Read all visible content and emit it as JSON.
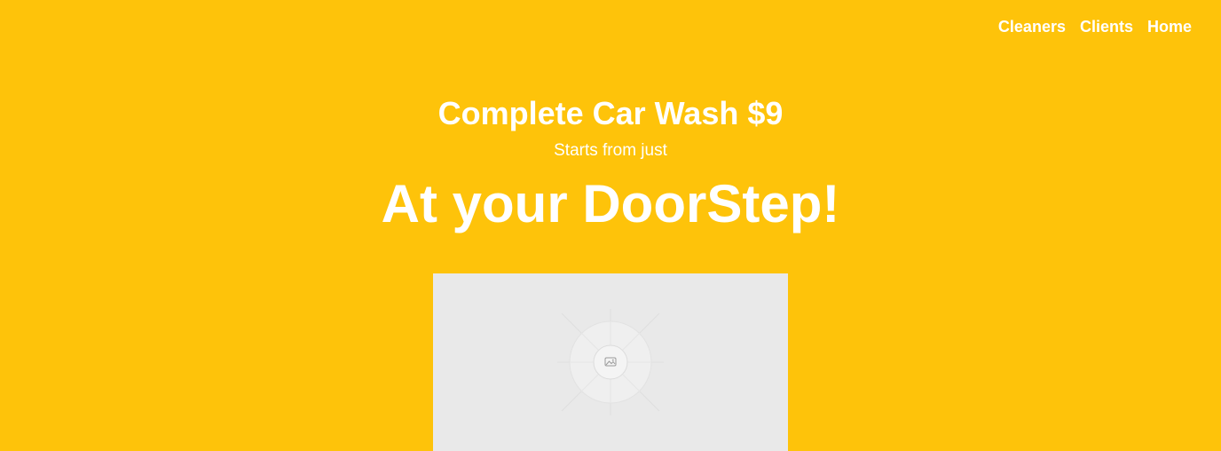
{
  "nav": {
    "items": [
      {
        "label": "Cleaners"
      },
      {
        "label": "Clients"
      },
      {
        "label": "Home"
      }
    ]
  },
  "hero": {
    "promo_title": "Complete Car Wash $9",
    "promo_subtitle": "Starts from just",
    "tagline": "At your DoorStep!"
  },
  "media": {
    "icon": "image-icon"
  },
  "colors": {
    "background": "#FEC30A",
    "text": "#FFFFFF",
    "placeholder": "#E9E9E9"
  }
}
